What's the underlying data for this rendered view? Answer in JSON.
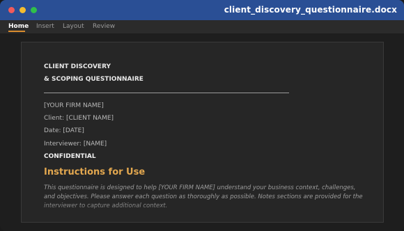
{
  "window": {
    "title": "client_discovery_questionnaire.docx"
  },
  "tabs": [
    {
      "label": "Home"
    },
    {
      "label": "Insert"
    },
    {
      "label": "Layout"
    },
    {
      "label": "Review"
    }
  ],
  "document": {
    "title_line1": "CLIENT DISCOVERY",
    "title_line2": "& SCOPING QUESTIONNAIRE",
    "firm_name": "[YOUR FIRM NAME]",
    "client": "Client: [CLIENT NAME]",
    "date": "Date: [DATE]",
    "interviewer": "Interviewer: [NAME]",
    "confidential": "CONFIDENTIAL",
    "section_heading": "Instructions for Use",
    "instructions": "This questionnaire is designed to help [YOUR FIRM NAME] understand your business context, challenges, and objectives. Please answer each question as thoroughly as possible. Notes sections are provided for the interviewer to capture additional context."
  },
  "colors": {
    "titlebar": "#2a4f95",
    "accent_heading": "#e2a74f",
    "tab_underline": "#d98c2e"
  }
}
